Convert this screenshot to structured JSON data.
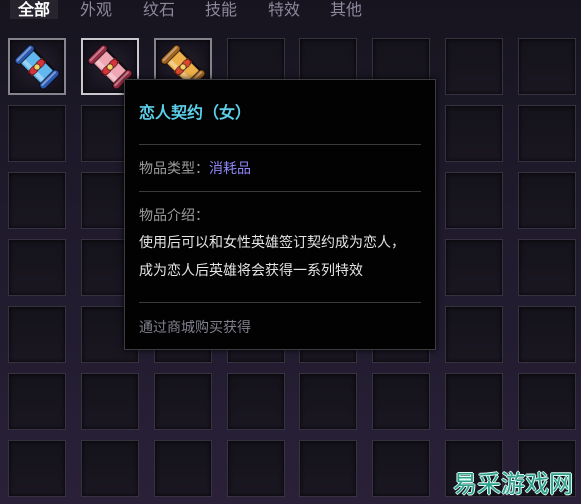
{
  "tabs": [
    {
      "label": "全部",
      "active": true
    },
    {
      "label": "外观",
      "active": false
    },
    {
      "label": "纹石",
      "active": false
    },
    {
      "label": "技能",
      "active": false
    },
    {
      "label": "特效",
      "active": false
    },
    {
      "label": "其他",
      "active": false
    }
  ],
  "inventory": {
    "items": [
      {
        "icon": "blue-scroll-icon",
        "highlighted": false,
        "colors": {
          "paper": "#62b8ee",
          "roller": "#2a58b0",
          "ribbon": "#d8333a"
        }
      },
      {
        "icon": "pink-scroll-icon",
        "highlighted": true,
        "colors": {
          "paper": "#f0a7b4",
          "roller": "#9a2c44",
          "ribbon": "#d8333a"
        }
      },
      {
        "icon": "gold-scroll-icon",
        "highlighted": false,
        "colors": {
          "paper": "#eeb04a",
          "roller": "#a2631e",
          "ribbon": "#d9472e"
        }
      }
    ]
  },
  "tooltip": {
    "title": "恋人契约（女）",
    "type_label": "物品类型：",
    "type_value": "消耗品",
    "description_label": "物品介绍：",
    "description": [
      "使用后可以和女性英雄签订契约成为恋人，",
      "成为恋人后英雄将会获得一系列特效"
    ],
    "source": "通过商城购买获得"
  },
  "watermark": "易采游戏网",
  "colors": {
    "tab_active": "#ffffff",
    "tab_inactive": "#8d889b",
    "title": "#5cd0ea",
    "label": "#9c9c9c",
    "type_value": "#8f87f7",
    "description": "#e4e4e4",
    "source": "#80808e",
    "watermark": "#2e9f8c"
  }
}
